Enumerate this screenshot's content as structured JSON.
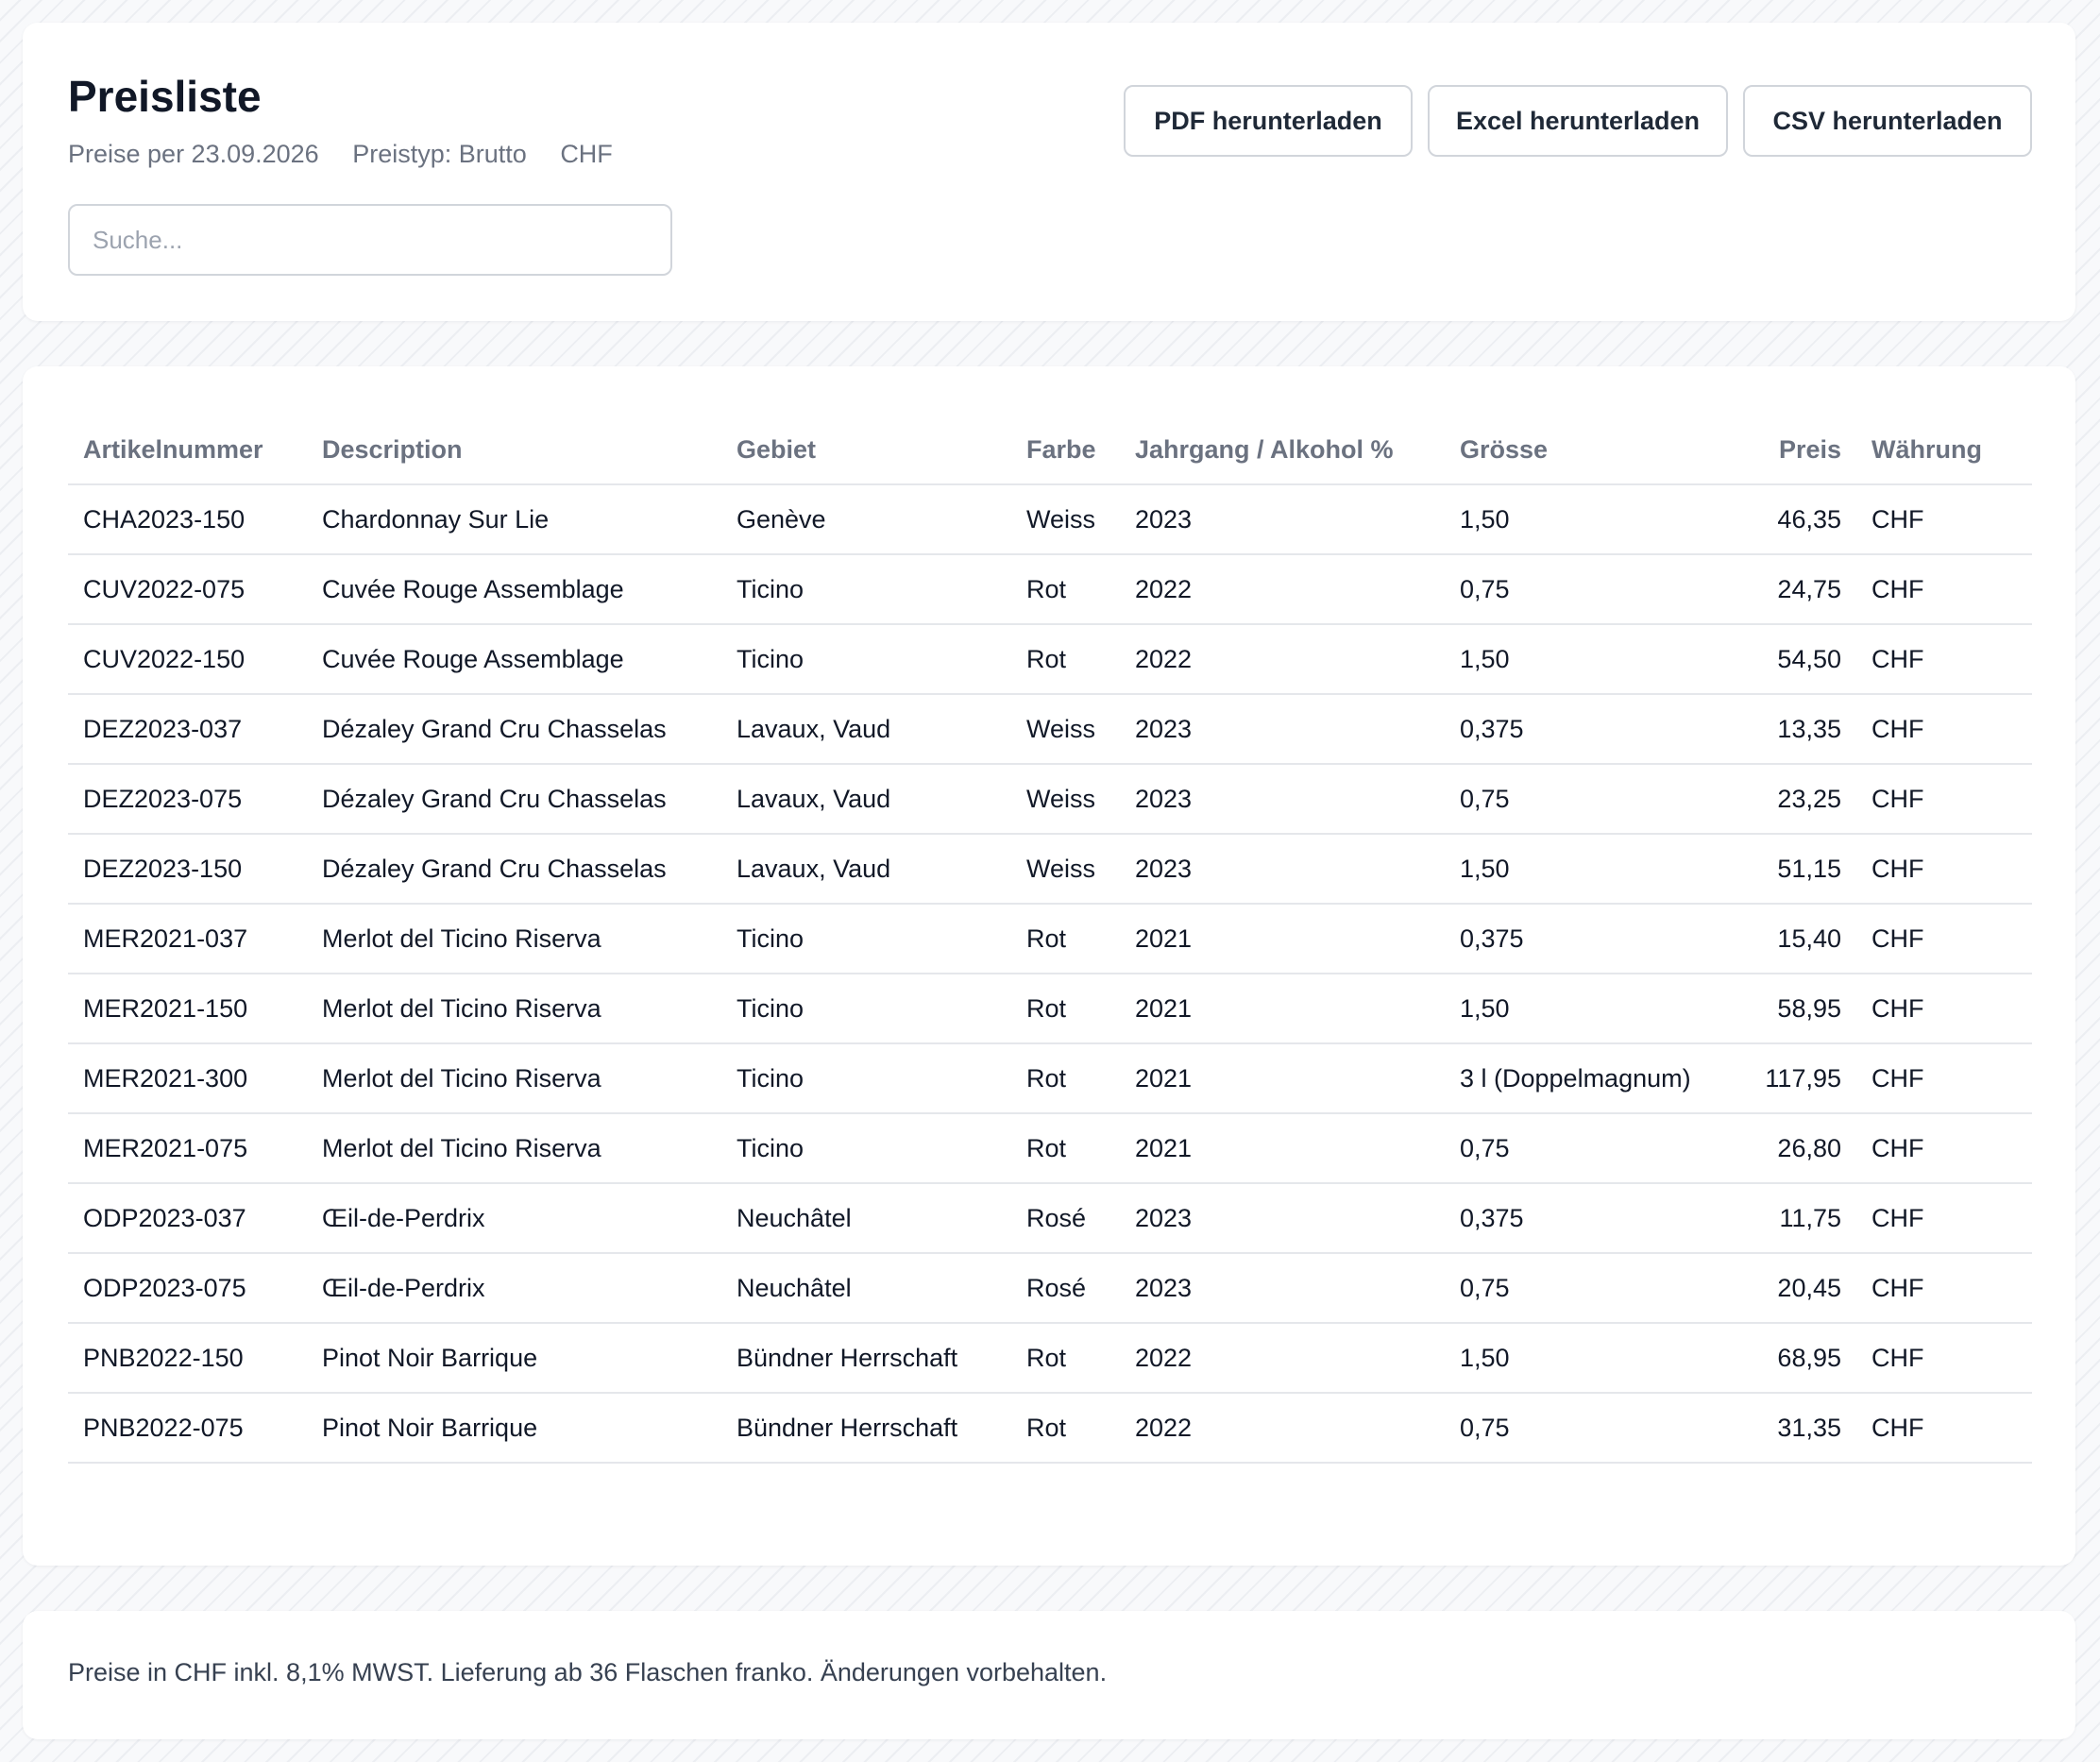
{
  "header": {
    "title": "Preisliste",
    "meta": {
      "date_label": "Preise per 23.09.2026",
      "price_type_label": "Preistyp: Brutto",
      "currency": "CHF"
    },
    "search": {
      "placeholder": "Suche...",
      "value": ""
    },
    "buttons": {
      "pdf": "PDF herunterladen",
      "excel": "Excel herunterladen",
      "csv": "CSV herunterladen"
    }
  },
  "table": {
    "columns": [
      "Artikelnummer",
      "Description",
      "Gebiet",
      "Farbe",
      "Jahrgang / Alkohol %",
      "Grösse",
      "Preis",
      "Währung"
    ],
    "rows": [
      [
        "CHA2023-150",
        "Chardonnay Sur Lie",
        "Genève",
        "Weiss",
        "2023",
        "1,50",
        "46,35",
        "CHF"
      ],
      [
        "CUV2022-075",
        "Cuvée Rouge Assemblage",
        "Ticino",
        "Rot",
        "2022",
        "0,75",
        "24,75",
        "CHF"
      ],
      [
        "CUV2022-150",
        "Cuvée Rouge Assemblage",
        "Ticino",
        "Rot",
        "2022",
        "1,50",
        "54,50",
        "CHF"
      ],
      [
        "DEZ2023-037",
        "Dézaley Grand Cru Chasselas",
        "Lavaux, Vaud",
        "Weiss",
        "2023",
        "0,375",
        "13,35",
        "CHF"
      ],
      [
        "DEZ2023-075",
        "Dézaley Grand Cru Chasselas",
        "Lavaux, Vaud",
        "Weiss",
        "2023",
        "0,75",
        "23,25",
        "CHF"
      ],
      [
        "DEZ2023-150",
        "Dézaley Grand Cru Chasselas",
        "Lavaux, Vaud",
        "Weiss",
        "2023",
        "1,50",
        "51,15",
        "CHF"
      ],
      [
        "MER2021-037",
        "Merlot del Ticino Riserva",
        "Ticino",
        "Rot",
        "2021",
        "0,375",
        "15,40",
        "CHF"
      ],
      [
        "MER2021-150",
        "Merlot del Ticino Riserva",
        "Ticino",
        "Rot",
        "2021",
        "1,50",
        "58,95",
        "CHF"
      ],
      [
        "MER2021-300",
        "Merlot del Ticino Riserva",
        "Ticino",
        "Rot",
        "2021",
        "3 l (Doppelmagnum)",
        "117,95",
        "CHF"
      ],
      [
        "MER2021-075",
        "Merlot del Ticino Riserva",
        "Ticino",
        "Rot",
        "2021",
        "0,75",
        "26,80",
        "CHF"
      ],
      [
        "ODP2023-037",
        "Œil-de-Perdrix",
        "Neuchâtel",
        "Rosé",
        "2023",
        "0,375",
        "11,75",
        "CHF"
      ],
      [
        "ODP2023-075",
        "Œil-de-Perdrix",
        "Neuchâtel",
        "Rosé",
        "2023",
        "0,75",
        "20,45",
        "CHF"
      ],
      [
        "PNB2022-150",
        "Pinot Noir Barrique",
        "Bündner Herrschaft",
        "Rot",
        "2022",
        "1,50",
        "68,95",
        "CHF"
      ],
      [
        "PNB2022-075",
        "Pinot Noir Barrique",
        "Bündner Herrschaft",
        "Rot",
        "2022",
        "0,75",
        "31,35",
        "CHF"
      ]
    ]
  },
  "footer": {
    "note": "Preise in CHF inkl. 8,1% MWST. Lieferung ab 36 Flaschen franko. Änderungen vorbehalten."
  }
}
